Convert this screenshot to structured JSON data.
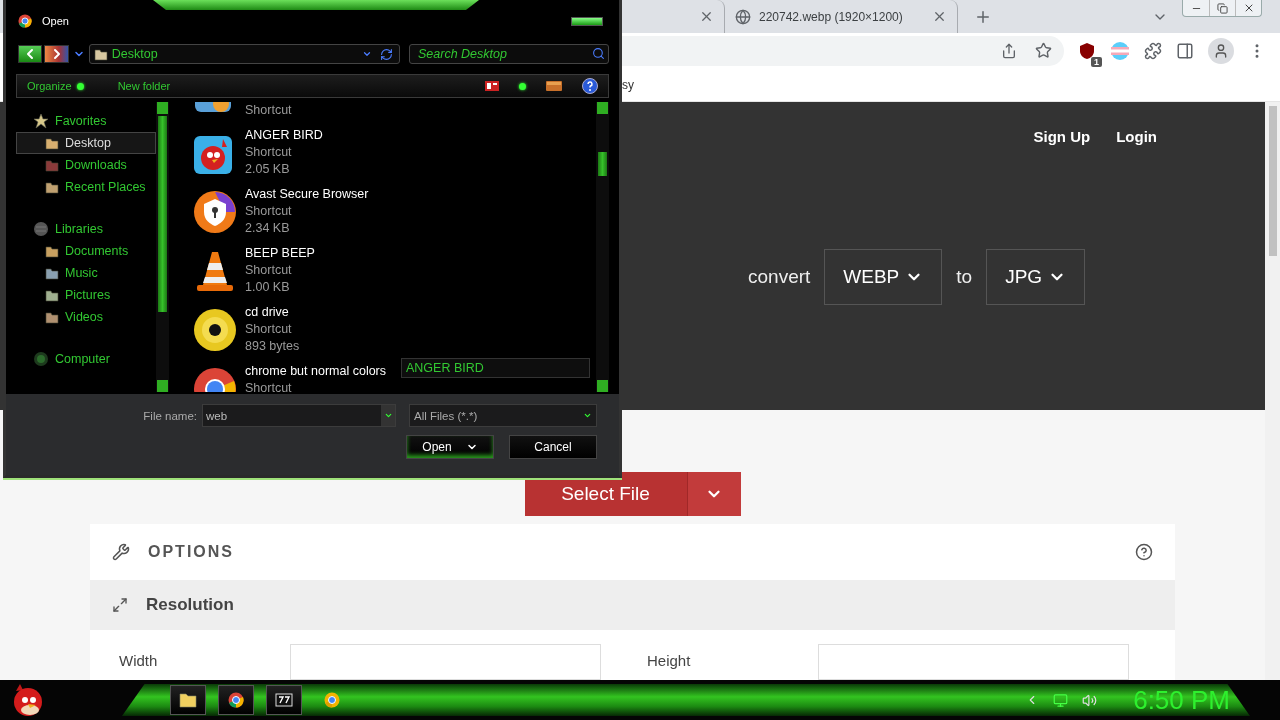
{
  "browser": {
    "tabs": [
      {
        "selected": false
      },
      {
        "title": "220742.webp (1920×1200)",
        "selected": false
      }
    ],
    "bookmark": "sy",
    "extension_badge": "1"
  },
  "page": {
    "nav": [
      "Sign Up",
      "Login"
    ],
    "convert": {
      "label": "convert",
      "from": "WEBP",
      "joiner": "to",
      "to": "JPG"
    },
    "select_button": "Select File",
    "options_title": "OPTIONS",
    "section": "Resolution",
    "fields": [
      "Width",
      "Height"
    ]
  },
  "dialog": {
    "title": "Open",
    "location": "Desktop",
    "search_placeholder": "Search Desktop",
    "toolbar": [
      "Organize",
      "New folder"
    ],
    "tree": [
      {
        "label": "Favorites",
        "selected": false,
        "children": [
          {
            "label": "Desktop",
            "selected": true
          },
          {
            "label": "Downloads",
            "selected": false
          },
          {
            "label": "Recent Places",
            "selected": false
          }
        ]
      },
      {
        "label": "Libraries",
        "selected": false,
        "children": [
          {
            "label": "Documents",
            "selected": false
          },
          {
            "label": "Music",
            "selected": false
          },
          {
            "label": "Pictures",
            "selected": false
          },
          {
            "label": "Videos",
            "selected": false
          }
        ]
      },
      {
        "label": "Computer",
        "selected": false
      }
    ],
    "files": [
      {
        "type": "Shortcut"
      },
      {
        "name": "ANGER BIRD",
        "type": "Shortcut",
        "size": "2.05 KB"
      },
      {
        "name": "Avast Secure Browser",
        "type": "Shortcut",
        "size": "2.34 KB"
      },
      {
        "name": "BEEP BEEP",
        "type": "Shortcut",
        "size": "1.00 KB"
      },
      {
        "name": "cd drive",
        "type": "Shortcut",
        "size": "893 bytes"
      },
      {
        "name": "chrome but normal colors",
        "type": "Shortcut"
      }
    ],
    "selected_name": "ANGER BIRD",
    "file_name_label": "File name:",
    "file_name": "web",
    "filter": "All Files (*.*)",
    "buttons": [
      "Open",
      "Cancel"
    ]
  },
  "taskbar": {
    "apps": [
      {
        "running": true
      },
      {
        "running": true
      },
      {
        "running": true
      },
      {
        "running": false
      }
    ],
    "clock": "6:50 PM"
  }
}
